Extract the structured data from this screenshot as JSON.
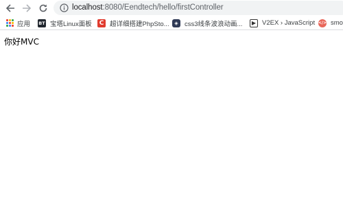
{
  "browser": {
    "address_bar": {
      "host": "localhost",
      "path": ":8080/Eendtech/hello/firstController"
    },
    "bookmarks": [
      {
        "label": "应用",
        "icon": "apps-grid-icon"
      },
      {
        "label": "宝塔Linux面板",
        "icon_text": "BT",
        "icon": "bt-panel-icon"
      },
      {
        "label": "超详细搭建PhpSto...",
        "icon_text": "C",
        "icon": "csdn-icon"
      },
      {
        "label": "css3线条波浪动画...",
        "icon_text": "◈",
        "icon": "css-site-icon"
      },
      {
        "label": "V2EX › JavaScript",
        "icon_text": "▶",
        "icon": "v2ex-icon"
      },
      {
        "label": "smoo",
        "icon_text": "</>",
        "icon": "smoo-icon"
      }
    ],
    "colors": {
      "omnibox_bg": "#f1f3f4",
      "apps_grid": [
        "#ea4335",
        "#fbbc05",
        "#34a853",
        "#4285f4",
        "#ea4335",
        "#fbbc05",
        "#34a853",
        "#4285f4",
        "#ea4335"
      ]
    }
  },
  "page": {
    "heading": "你好MVC"
  }
}
